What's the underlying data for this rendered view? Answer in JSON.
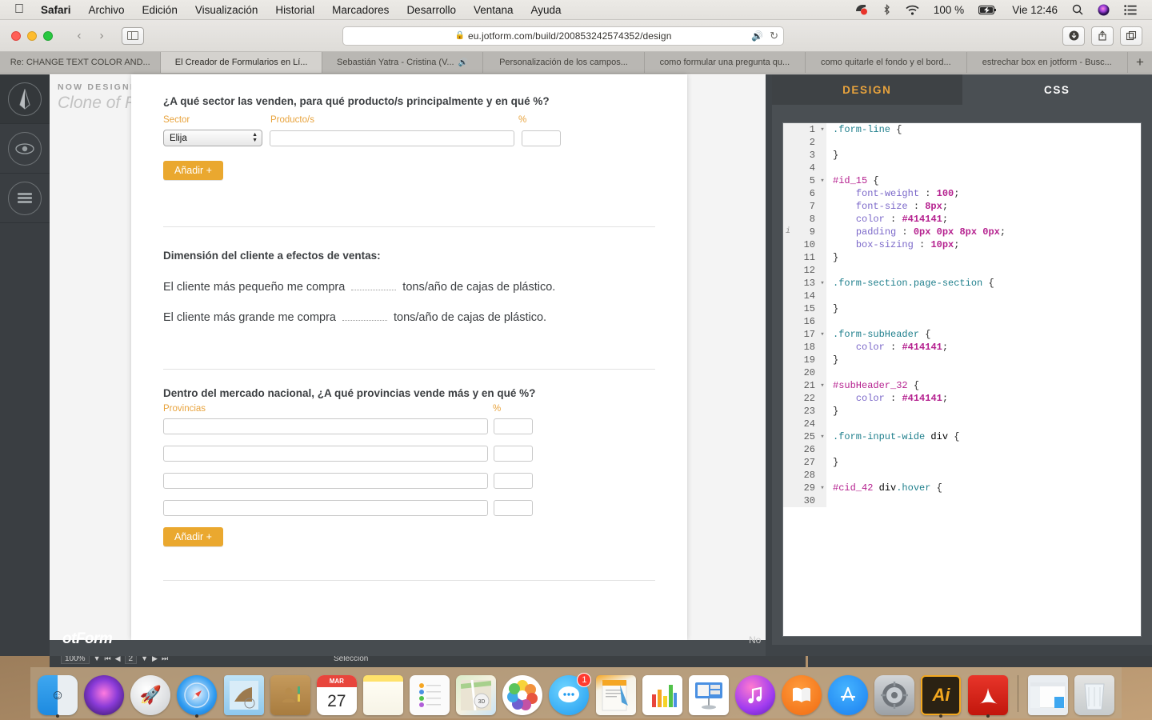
{
  "menubar": {
    "apple": "apple-logo",
    "items": [
      {
        "label": "Safari",
        "bold": true
      },
      {
        "label": "Archivo",
        "bold": false
      },
      {
        "label": "Edición",
        "bold": false
      },
      {
        "label": "Visualización",
        "bold": false
      },
      {
        "label": "Historial",
        "bold": false
      },
      {
        "label": "Marcadores",
        "bold": false
      },
      {
        "label": "Desarrollo",
        "bold": false
      },
      {
        "label": "Ventana",
        "bold": false
      },
      {
        "label": "Ayuda",
        "bold": false
      }
    ],
    "status": {
      "battery_percent": "100 %",
      "datetime": "Vie 12:46",
      "icons": [
        "screen-record-icon",
        "bluetooth-icon",
        "wifi-icon",
        "battery-charging-icon",
        "spotlight-search-icon",
        "siri-icon",
        "control-center-icon"
      ]
    }
  },
  "browser": {
    "url": "eu.jotform.com/build/200853242574352/design",
    "lock_icon": "lock-icon",
    "back_label": "‹",
    "forward_label": "›",
    "tabs": [
      {
        "label": "Re: CHANGE TEXT COLOR AND...",
        "active": false,
        "audio": false
      },
      {
        "label": "El Creador de Formularios en Lí...",
        "active": true,
        "audio": false
      },
      {
        "label": "Sebastián Yatra - Cristina (V...",
        "active": false,
        "audio": true
      },
      {
        "label": "Personalización de los campos...",
        "active": false,
        "audio": false
      },
      {
        "label": "como formular una pregunta qu...",
        "active": false,
        "audio": false
      },
      {
        "label": "como quitarle el fondo y el bord...",
        "active": false,
        "audio": false
      },
      {
        "label": "estrechar box en jotform - Busc...",
        "active": false,
        "audio": false
      }
    ],
    "new_tab_label": "+"
  },
  "builder": {
    "now_designing_label": "NOW DESIGNING",
    "form_title": "Clone of Fabricantes",
    "rail_icons": [
      "pen-designer-icon",
      "eye-preview-icon",
      "menu-icon"
    ],
    "footer_logo": "otForm",
    "footer_right": "No",
    "sections": [
      {
        "heading": "¿A qué sector las venden, para qué producto/s principalmente y en qué %?",
        "columns": [
          "Sector",
          "Producto/s",
          "%"
        ],
        "select_value": "Elija",
        "text_value": "",
        "pct_value": "",
        "add_button": "Añadir +"
      },
      {
        "heading": "Dimensión del cliente a efectos de ventas:",
        "statements": [
          {
            "before": "El cliente más pequeño me compra",
            "after": "tons/año de cajas de plástico.",
            "value": ""
          },
          {
            "before": "El cliente más grande me compra",
            "after": "tons/año de cajas de plástico.",
            "value": ""
          }
        ]
      },
      {
        "heading": "Dentro del mercado nacional, ¿A qué provincias vende más y en qué %?",
        "columns": [
          "Provincias",
          "%"
        ],
        "rows": [
          {
            "provincia": "",
            "pct": ""
          },
          {
            "provincia": "",
            "pct": ""
          },
          {
            "provincia": "",
            "pct": ""
          },
          {
            "provincia": "",
            "pct": ""
          }
        ],
        "add_button": "Añadir +"
      }
    ]
  },
  "right_panel": {
    "tabs": [
      {
        "label": "DESIGN",
        "active": true
      },
      {
        "label": "CSS",
        "active": false
      }
    ],
    "accent_color": "#e8a33d",
    "css_lines": [
      {
        "n": 1,
        "fold": true,
        "info": false,
        "text": ".form-line {"
      },
      {
        "n": 2,
        "fold": false,
        "info": false,
        "text": ""
      },
      {
        "n": 3,
        "fold": false,
        "info": false,
        "text": "}"
      },
      {
        "n": 4,
        "fold": false,
        "info": false,
        "text": ""
      },
      {
        "n": 5,
        "fold": true,
        "info": false,
        "text": "#id_15 {"
      },
      {
        "n": 6,
        "fold": false,
        "info": false,
        "text": "    font-weight : 100;"
      },
      {
        "n": 7,
        "fold": false,
        "info": false,
        "text": "    font-size : 8px;"
      },
      {
        "n": 8,
        "fold": false,
        "info": false,
        "text": "    color : #414141;"
      },
      {
        "n": 9,
        "fold": false,
        "info": true,
        "text": "    padding : 0px 0px 8px 0px;"
      },
      {
        "n": 10,
        "fold": false,
        "info": false,
        "text": "    box-sizing : 10px;"
      },
      {
        "n": 11,
        "fold": false,
        "info": false,
        "text": "}"
      },
      {
        "n": 12,
        "fold": false,
        "info": false,
        "text": ""
      },
      {
        "n": 13,
        "fold": true,
        "info": false,
        "text": ".form-section.page-section {"
      },
      {
        "n": 14,
        "fold": false,
        "info": false,
        "text": ""
      },
      {
        "n": 15,
        "fold": false,
        "info": false,
        "text": "}"
      },
      {
        "n": 16,
        "fold": false,
        "info": false,
        "text": ""
      },
      {
        "n": 17,
        "fold": true,
        "info": false,
        "text": ".form-subHeader {"
      },
      {
        "n": 18,
        "fold": false,
        "info": false,
        "text": "    color : #414141;"
      },
      {
        "n": 19,
        "fold": false,
        "info": false,
        "text": "}"
      },
      {
        "n": 20,
        "fold": false,
        "info": false,
        "text": ""
      },
      {
        "n": 21,
        "fold": true,
        "info": false,
        "text": "#subHeader_32 {"
      },
      {
        "n": 22,
        "fold": false,
        "info": false,
        "text": "    color : #414141;"
      },
      {
        "n": 23,
        "fold": false,
        "info": false,
        "text": "}"
      },
      {
        "n": 24,
        "fold": false,
        "info": false,
        "text": ""
      },
      {
        "n": 25,
        "fold": true,
        "info": false,
        "text": ".form-input-wide div {"
      },
      {
        "n": 26,
        "fold": false,
        "info": false,
        "text": ""
      },
      {
        "n": 27,
        "fold": false,
        "info": false,
        "text": "}"
      },
      {
        "n": 28,
        "fold": false,
        "info": false,
        "text": ""
      },
      {
        "n": 29,
        "fold": true,
        "info": false,
        "text": "#cid_42 div.hover {"
      },
      {
        "n": 30,
        "fold": false,
        "info": false,
        "text": ""
      }
    ]
  },
  "illustrator_bar": {
    "zoom": "100%",
    "page": "2",
    "status": "Selección"
  },
  "dock": {
    "items": [
      {
        "name": "finder",
        "label": "Finder",
        "running": true
      },
      {
        "name": "siri",
        "label": "Siri",
        "running": false
      },
      {
        "name": "launchpad",
        "label": "Launchpad",
        "running": false
      },
      {
        "name": "safari",
        "label": "Safari",
        "running": true
      },
      {
        "name": "mail",
        "label": "Mail",
        "running": false
      },
      {
        "name": "contacts",
        "label": "Contactos",
        "running": false
      },
      {
        "name": "calendar",
        "label": "Calendario",
        "running": false,
        "month": "MAR",
        "day": "27"
      },
      {
        "name": "notes",
        "label": "Notas",
        "running": false
      },
      {
        "name": "reminders",
        "label": "Recordatorios",
        "running": false
      },
      {
        "name": "maps",
        "label": "Mapas",
        "running": false
      },
      {
        "name": "photos",
        "label": "Fotos",
        "running": false
      },
      {
        "name": "messages",
        "label": "Mensajes",
        "running": false,
        "badge": "1"
      },
      {
        "name": "pages",
        "label": "Pages",
        "running": false
      },
      {
        "name": "numbers",
        "label": "Numbers",
        "running": false
      },
      {
        "name": "keynote",
        "label": "Keynote",
        "running": false
      },
      {
        "name": "itunes",
        "label": "iTunes",
        "running": false
      },
      {
        "name": "ibooks",
        "label": "iBooks",
        "running": false
      },
      {
        "name": "appstore",
        "label": "App Store",
        "running": false
      },
      {
        "name": "system-preferences",
        "label": "Preferencias del Sistema",
        "running": false
      },
      {
        "name": "illustrator",
        "label": "Ai",
        "running": true
      },
      {
        "name": "acrobat",
        "label": "Acrobat",
        "running": true
      }
    ],
    "right_items": [
      {
        "name": "finder-window",
        "label": "Ventana"
      },
      {
        "name": "trash",
        "label": "Papelera"
      }
    ]
  }
}
